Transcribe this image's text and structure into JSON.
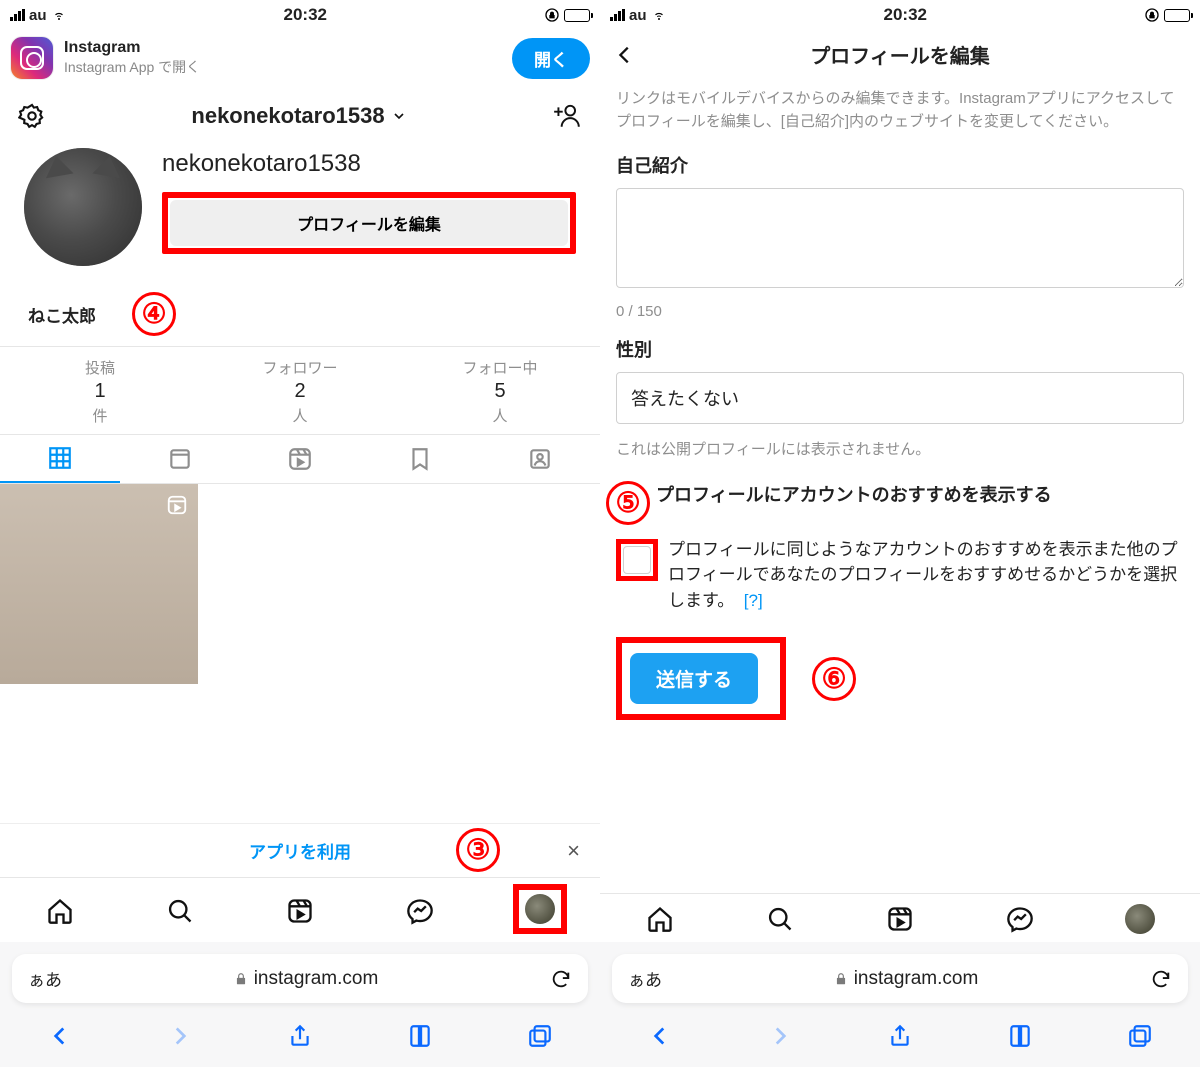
{
  "status": {
    "carrier": "au",
    "time": "20:32"
  },
  "banner": {
    "title": "Instagram",
    "subtitle": "Instagram App で開く",
    "open": "開く"
  },
  "profile": {
    "username": "nekonekotaro1538",
    "edit_label": "プロフィールを編集",
    "display_name": "ねこ太郎"
  },
  "stats": {
    "posts_label": "投稿",
    "posts_value": "1",
    "posts_unit": "件",
    "followers_label": "フォロワー",
    "followers_value": "2",
    "followers_unit": "人",
    "following_label": "フォロー中",
    "following_value": "5",
    "following_unit": "人"
  },
  "useapp": {
    "label": "アプリを利用",
    "close": "×"
  },
  "url": {
    "aa": "ぁあ",
    "domain": "instagram.com"
  },
  "step3": "③",
  "step4": "④",
  "step5": "⑤",
  "step6": "⑥",
  "edit": {
    "title": "プロフィールを編集",
    "help": "リンクはモバイルデバイスからのみ編集できます。Instagramアプリにアクセスしてプロフィールを編集し、[自己紹介]内のウェブサイトを変更してください。",
    "bio_label": "自己紹介",
    "bio_counter": "0 / 150",
    "gender_label": "性別",
    "gender_value": "答えたくない",
    "gender_hint": "これは公開プロフィールには表示されません。",
    "rec_title": "プロフィールにアカウントのおすすめを表示する",
    "rec_text": "プロフィールに同じようなアカウントのおすすめを表示また他のプロフィールであなたのプロフィールをおすすめせるかどうかを選択します。",
    "rec_help": "[?]",
    "submit": "送信する"
  }
}
